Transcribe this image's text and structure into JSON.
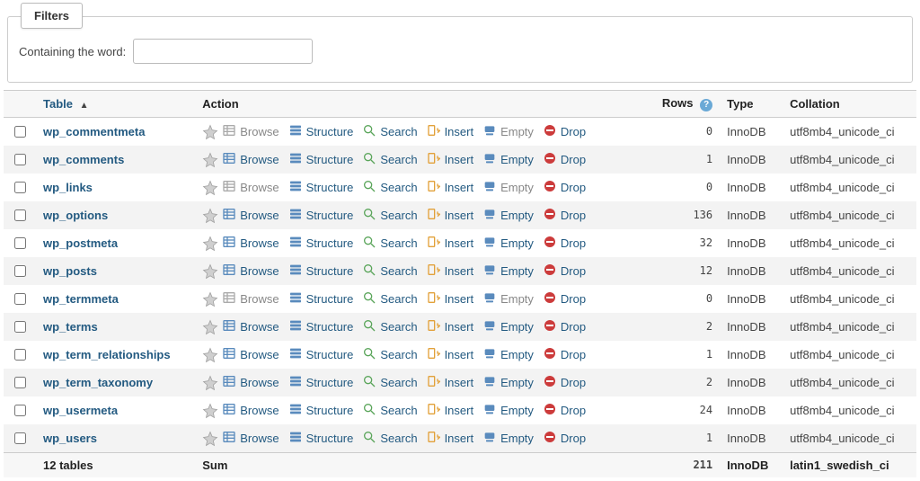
{
  "filters": {
    "tab_label": "Filters",
    "containing_label": "Containing the word:",
    "containing_value": ""
  },
  "columns": {
    "table": "Table",
    "action": "Action",
    "rows": "Rows",
    "type": "Type",
    "collation": "Collation"
  },
  "action_labels": {
    "browse": "Browse",
    "structure": "Structure",
    "search": "Search",
    "insert": "Insert",
    "empty": "Empty",
    "drop": "Drop"
  },
  "tables": [
    {
      "name": "wp_commentmeta",
      "rows": 0,
      "type": "InnoDB",
      "collation": "utf8mb4_unicode_ci",
      "browsable": false
    },
    {
      "name": "wp_comments",
      "rows": 1,
      "type": "InnoDB",
      "collation": "utf8mb4_unicode_ci",
      "browsable": true
    },
    {
      "name": "wp_links",
      "rows": 0,
      "type": "InnoDB",
      "collation": "utf8mb4_unicode_ci",
      "browsable": false
    },
    {
      "name": "wp_options",
      "rows": 136,
      "type": "InnoDB",
      "collation": "utf8mb4_unicode_ci",
      "browsable": true
    },
    {
      "name": "wp_postmeta",
      "rows": 32,
      "type": "InnoDB",
      "collation": "utf8mb4_unicode_ci",
      "browsable": true
    },
    {
      "name": "wp_posts",
      "rows": 12,
      "type": "InnoDB",
      "collation": "utf8mb4_unicode_ci",
      "browsable": true
    },
    {
      "name": "wp_termmeta",
      "rows": 0,
      "type": "InnoDB",
      "collation": "utf8mb4_unicode_ci",
      "browsable": false
    },
    {
      "name": "wp_terms",
      "rows": 2,
      "type": "InnoDB",
      "collation": "utf8mb4_unicode_ci",
      "browsable": true
    },
    {
      "name": "wp_term_relationships",
      "rows": 1,
      "type": "InnoDB",
      "collation": "utf8mb4_unicode_ci",
      "browsable": true
    },
    {
      "name": "wp_term_taxonomy",
      "rows": 2,
      "type": "InnoDB",
      "collation": "utf8mb4_unicode_ci",
      "browsable": true
    },
    {
      "name": "wp_usermeta",
      "rows": 24,
      "type": "InnoDB",
      "collation": "utf8mb4_unicode_ci",
      "browsable": true
    },
    {
      "name": "wp_users",
      "rows": 1,
      "type": "InnoDB",
      "collation": "utf8mb4_unicode_ci",
      "browsable": true
    }
  ],
  "summary": {
    "count_label": "12 tables",
    "sum_label": "Sum",
    "rows_total": 211,
    "type": "InnoDB",
    "collation": "latin1_swedish_ci"
  }
}
